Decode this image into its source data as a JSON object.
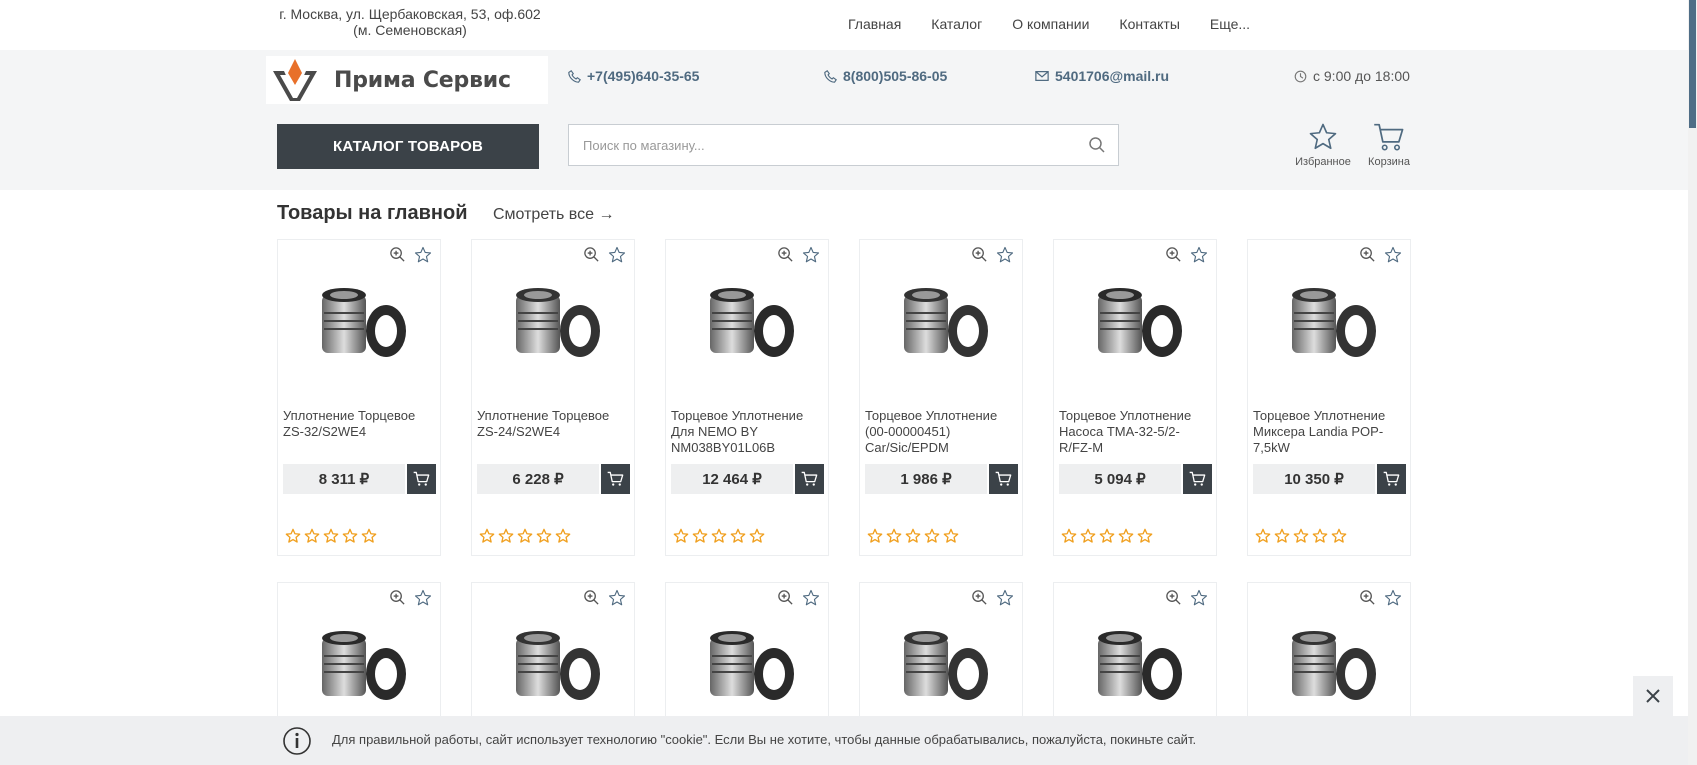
{
  "top": {
    "address_line1": "г. Москва, ул. Щербаковская, 53, оф.602",
    "address_line2": "(м. Семеновская)",
    "nav": [
      "Главная",
      "Каталог",
      "О компании",
      "Контакты",
      "Еще..."
    ]
  },
  "header": {
    "logo_text": "Прима Сервис",
    "phone1": "+7(495)640-35-65",
    "phone2": "8(800)505-86-05",
    "email": "5401706@mail.ru",
    "hours": "с 9:00 до 18:00",
    "catalog_button": "КАТАЛОГ ТОВАРОВ",
    "search_placeholder": "Поиск по магазину...",
    "favorites_label": "Избранное",
    "cart_label": "Корзина"
  },
  "section": {
    "title": "Товары на главной",
    "see_all": "Смотреть все →"
  },
  "products": [
    {
      "name": "Уплотнение Торцевое ZS-32/S2WE4",
      "price": "8 311 ₽",
      "rating": 0
    },
    {
      "name": "Уплотнение Торцевое ZS-24/S2WE4",
      "price": "6 228 ₽",
      "rating": 0
    },
    {
      "name": "Торцевое Уплотнение Для NEMO BY NM038BY01L06B",
      "price": "12 464 ₽",
      "rating": 0
    },
    {
      "name": "Торцевое Уплотнение (00-00000451) Car/Sic/EPDM",
      "price": "1 986 ₽",
      "rating": 0
    },
    {
      "name": "Торцевое Уплотнение Насоса TMA-32-5/2-R/FZ-M",
      "price": "5 094 ₽",
      "rating": 0
    },
    {
      "name": "Торцевое Уплотнение Миксера Landia POP-7,5kW",
      "price": "10 350 ₽",
      "rating": 0
    }
  ],
  "cookie": {
    "message": "Для правильной работы, сайт использует технологию \"cookie\". Если Вы не хотите, чтобы данные обрабатывались, пожалуйста, покиньте сайт."
  },
  "colors": {
    "accent_dark": "#3b4248",
    "link_blue": "#4f6a80",
    "star_orange": "#f0a020",
    "logo_orange": "#e8702a"
  }
}
